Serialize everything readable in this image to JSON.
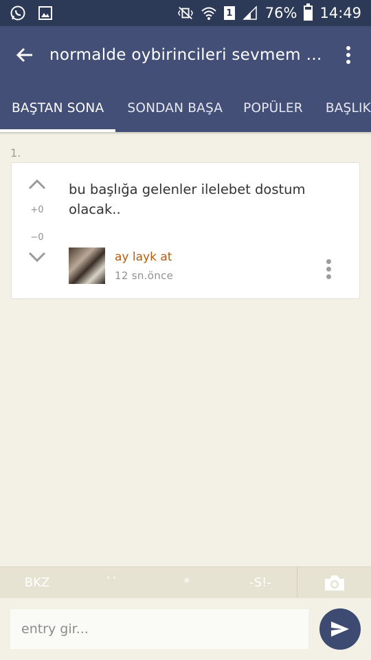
{
  "status_bar": {
    "left_icons": [
      "whatsapp-icon",
      "gallery-icon"
    ],
    "right_icons": [
      "vibrate-mute-icon",
      "wifi-icon",
      "sim-icon",
      "signal-icon",
      "battery-icon"
    ],
    "sim_slot": "1",
    "battery_percent": "76%",
    "battery_level": 0.76,
    "time": "14:49"
  },
  "app_bar": {
    "title": "normalde oybirincileri sevmem ama...",
    "back_icon": "arrow-left-icon",
    "menu_icon": "more-vert-icon"
  },
  "tabs": [
    {
      "label": "BAŞTAN SONA",
      "active": true
    },
    {
      "label": "SONDAN BAŞA",
      "active": false
    },
    {
      "label": "POPÜLER",
      "active": false
    },
    {
      "label": "BAŞLIK",
      "active": false
    }
  ],
  "entry": {
    "number": "1.",
    "text": "bu başlığa gelenler ilelebet dostum olacak..",
    "upvotes": "+0",
    "downvotes": "−0",
    "author": "ay layk at",
    "time": "12 sn.önce"
  },
  "toolbar": {
    "bkz": "BKZ",
    "tick": "``",
    "star": "*",
    "spoiler": "-S!-",
    "camera_icon": "camera-icon"
  },
  "input": {
    "placeholder": "entry gir...",
    "send_icon": "send-icon"
  },
  "colors": {
    "status_bar": "#2c3957",
    "app_bar": "#434f77",
    "background": "#f3f1e6",
    "author": "#b85a07",
    "send_button": "#3d4a72"
  }
}
